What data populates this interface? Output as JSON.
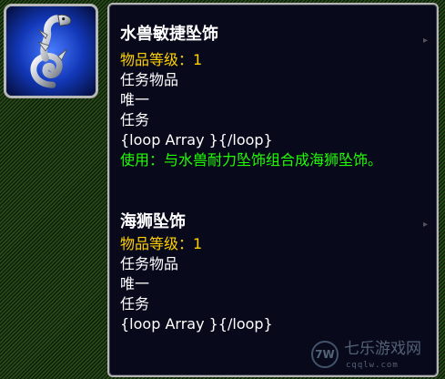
{
  "icon": {
    "name": "serpent-icon",
    "colors": {
      "background": "#0d2a8a",
      "glow": "#4a7dff",
      "body": "#cfd3d8"
    }
  },
  "tooltip": {
    "items": [
      {
        "title": "水兽敏捷坠饰",
        "level": "物品等级：1",
        "type": "任务物品",
        "unique": "唯一",
        "quest": "任务",
        "loop": "{loop Array }{/loop}",
        "use": "使用：与水兽耐力坠饰组合成海狮坠饰。"
      },
      {
        "title": "海狮坠饰",
        "level": "物品等级：1",
        "type": "任务物品",
        "unique": "唯一",
        "quest": "任务",
        "loop": "{loop Array }{/loop}"
      }
    ],
    "colors": {
      "title": "#ffffff",
      "level": "#ffd100",
      "use": "#1eff00",
      "text": "#ffffff",
      "background": "#09091c"
    }
  },
  "watermark": {
    "logo": "7W",
    "text": "七乐游戏网",
    "url": "cqqlw.com"
  }
}
